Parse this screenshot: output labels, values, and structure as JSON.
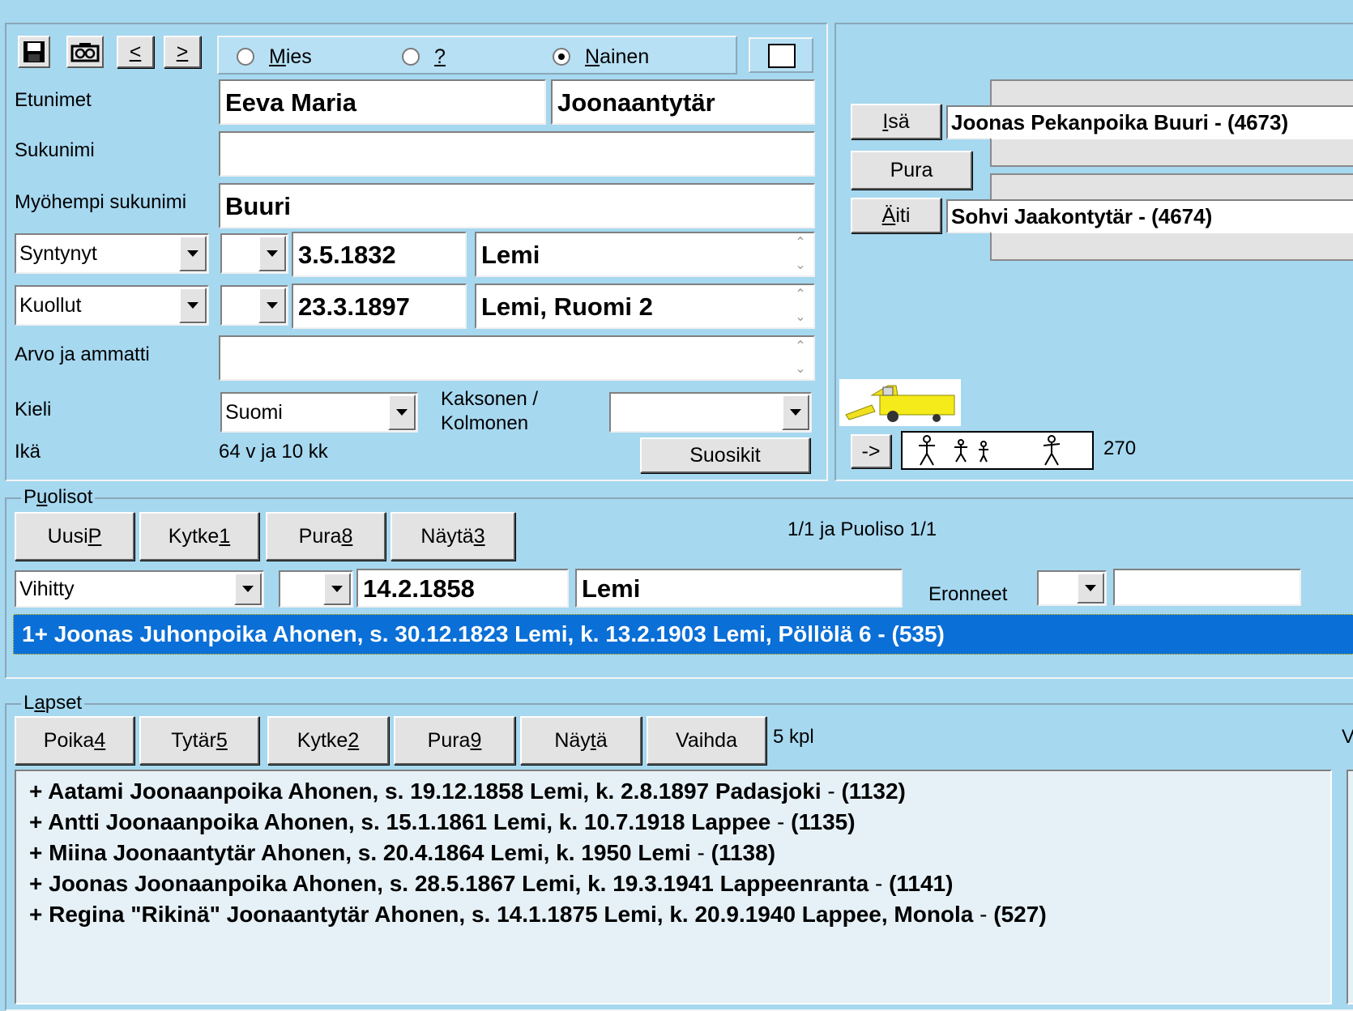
{
  "toolbar": {
    "prev_label": "<",
    "next_label": ">"
  },
  "gender": {
    "options": [
      {
        "label_pre": "",
        "label_acc": "M",
        "label_post": "ies",
        "selected": false
      },
      {
        "label_pre": "",
        "label_acc": "?",
        "label_post": "",
        "selected": false
      },
      {
        "label_pre": "",
        "label_acc": "N",
        "label_post": "ainen",
        "selected": true
      }
    ]
  },
  "person": {
    "labels": {
      "first_names": "Etunimet",
      "surname": "Sukunimi",
      "later_surname": "Myöhempi sukunimi",
      "title_occupation": "Arvo ja ammatti",
      "language": "Kieli",
      "twin": "Kaksonen /",
      "twin2": "Kolmonen",
      "age": "Ikä"
    },
    "first_names": "Eeva Maria",
    "patronymic": "Joonaantytär",
    "surname": "",
    "later_surname": "Buuri",
    "birth": {
      "event": "Syntynyt",
      "qualifier": "",
      "date": "3.5.1832",
      "place": "Lemi"
    },
    "death": {
      "event": "Kuollut",
      "qualifier": "",
      "date": "23.3.1897",
      "place": "Lemi, Ruomi 2"
    },
    "title_occupation": "",
    "language": "Suomi",
    "twin": "",
    "age": "64 v ja 10 kk",
    "favorites_label": "Suosikit"
  },
  "parents": {
    "father_btn_acc": "I",
    "father_btn_post": "sä",
    "father": "Joonas Pekanpoika Buuri - (4673)",
    "unlink_label": "Pura",
    "mother_btn_acc": "Ä",
    "mother_btn_post": "iti",
    "mother": "Sohvi Jaakontytär - (4674)",
    "arrow_label": "->",
    "count": "270"
  },
  "spouses": {
    "title_pre": "P",
    "title_acc": "u",
    "title_post": "olisot",
    "buttons": [
      {
        "pre": "Uusi ",
        "acc": "P"
      },
      {
        "pre": "Kytke ",
        "acc": "1"
      },
      {
        "pre": "Pura ",
        "acc": "8"
      },
      {
        "pre": "Näytä ",
        "acc": "3"
      }
    ],
    "status": "1/1 ja Puoliso 1/1",
    "marriage": {
      "event": "Vihitty",
      "qualifier": "",
      "date": "14.2.1858",
      "place": "Lemi"
    },
    "divorced_label": "Eronneet",
    "divorced_qualifier": "",
    "divorced_date": "",
    "selected": "1+ Joonas Juhonpoika Ahonen,  s. 30.12.1823 Lemi, k. 13.2.1903 Lemi, Pöllölä 6 - (535)"
  },
  "children": {
    "title_pre": "L",
    "title_acc": "a",
    "title_post": "pset",
    "buttons": [
      {
        "pre": "Poika ",
        "acc": "4",
        "post": ""
      },
      {
        "pre": "Tytär ",
        "acc": "5",
        "post": ""
      },
      {
        "pre": "Kytke ",
        "acc": "2",
        "post": ""
      },
      {
        "pre": "Pura ",
        "acc": "9",
        "post": ""
      },
      {
        "pre": "Näy",
        "acc": "t",
        "post": "ä"
      },
      {
        "pre": "Vaihda",
        "acc": "",
        "post": ""
      }
    ],
    "count": "5 kpl",
    "right_cut": "V",
    "items": [
      {
        "name": "+ Aatami Joonaanpoika Ahonen,  s. 19.12.1858 Lemi, k. 2.8.1897 Padasjoki",
        "sep": " - ",
        "id": "(1132)"
      },
      {
        "name": "+ Antti Joonaanpoika Ahonen,  s. 15.1.1861 Lemi, k. 10.7.1918 Lappee",
        "sep": " - ",
        "id": "(1135)"
      },
      {
        "name": "+ Miina Joonaantytär Ahonen,  s. 20.4.1864 Lemi, k. 1950 Lemi",
        "sep": " - ",
        "id": "(1138)"
      },
      {
        "name": "+ Joonas Joonaanpoika Ahonen,  s. 28.5.1867 Lemi, k. 19.3.1941 Lappeenranta",
        "sep": " - ",
        "id": "(1141)"
      },
      {
        "name": "+ Regina \"Rikinä\" Joonaantytär Ahonen,  s. 14.1.1875 Lemi, k. 20.9.1940 Lappee, Monola",
        "sep": " - ",
        "id": "(527)"
      }
    ]
  },
  "icons": [
    "save-icon",
    "camera-icon",
    "harvester-icon",
    "family-figures-icon"
  ],
  "colors": {
    "background": "#a6d8f0",
    "selection": "#0a6fd6",
    "button": "#e3e3e3",
    "list": "#e6f1f7"
  }
}
